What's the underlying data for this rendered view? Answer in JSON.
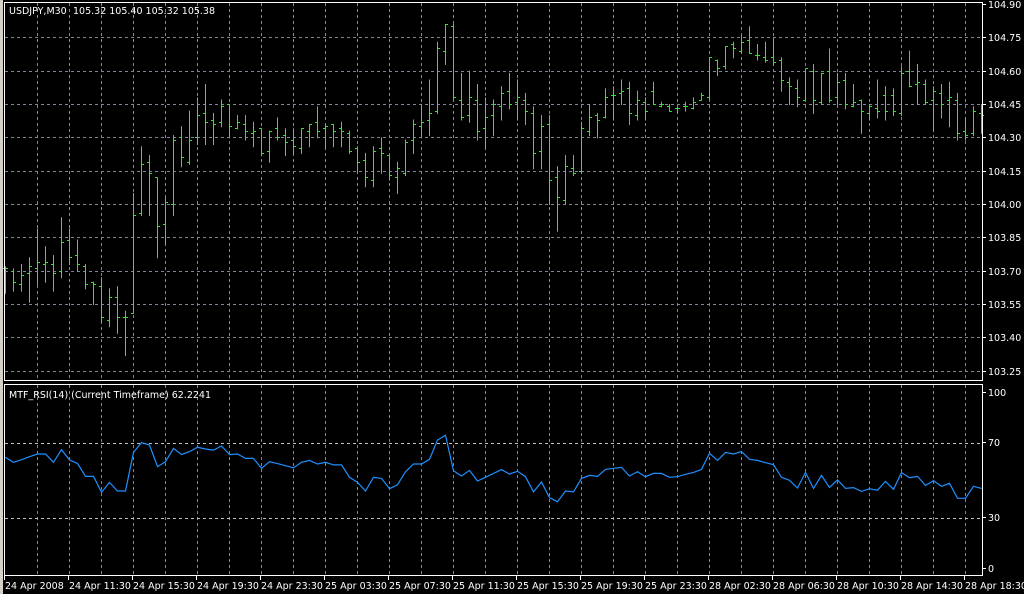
{
  "header": {
    "symbol": "USDJPY,M30",
    "ohlc_text": "105.32 105.40 105.32 105.38"
  },
  "indicator": {
    "label": "MTF_RSI(14) (Current Timeframe) 62.2241"
  },
  "price_axis": [
    "104.90",
    "104.75",
    "104.60",
    "104.45",
    "104.30",
    "104.15",
    "104.00",
    "103.85",
    "103.70",
    "103.55",
    "103.40",
    "103.25"
  ],
  "rsi_axis": [
    "100",
    "70",
    "30",
    "0"
  ],
  "time_axis": [
    "24 Apr 2008",
    "24 Apr 11:30",
    "24 Apr 15:30",
    "24 Apr 19:30",
    "24 Apr 23:30",
    "25 Apr 03:30",
    "25 Apr 07:30",
    "25 Apr 11:30",
    "25 Apr 15:30",
    "25 Apr 19:30",
    "25 Apr 23:30",
    "28 Apr 02:30",
    "28 Apr 06:30",
    "28 Apr 10:30",
    "28 Apr 14:30",
    "28 Apr 18:30"
  ],
  "colors": {
    "bars": "#2ee82e",
    "grid": "#778899",
    "rsi": "#1e90ff",
    "axis": "#ffffff",
    "background": "#000000"
  },
  "chart_data": [
    {
      "type": "ohlc",
      "title": "USDJPY,M30",
      "timeframe": "M30",
      "ylim": [
        103.25,
        104.9
      ],
      "grid": true,
      "bar_format": [
        "open",
        "high",
        "low",
        "close"
      ],
      "bars": [
        [
          103.71,
          103.72,
          103.6,
          103.71
        ],
        [
          103.7,
          103.71,
          103.61,
          103.65
        ],
        [
          103.64,
          103.73,
          103.61,
          103.68
        ],
        [
          103.69,
          103.76,
          103.56,
          103.72
        ],
        [
          103.71,
          103.89,
          103.64,
          103.74
        ],
        [
          103.73,
          103.81,
          103.65,
          103.74
        ],
        [
          103.73,
          103.77,
          103.61,
          103.69
        ],
        [
          103.7,
          103.94,
          103.67,
          103.83
        ],
        [
          103.84,
          103.89,
          103.73,
          103.76
        ],
        [
          103.77,
          103.84,
          103.7,
          103.73
        ],
        [
          103.72,
          103.73,
          103.62,
          103.64
        ],
        [
          103.65,
          103.65,
          103.55,
          103.64
        ],
        [
          103.63,
          103.67,
          103.47,
          103.49
        ],
        [
          103.48,
          103.62,
          103.45,
          103.58
        ],
        [
          103.58,
          103.63,
          103.42,
          103.49
        ],
        [
          103.49,
          103.52,
          103.32,
          103.49
        ],
        [
          103.51,
          104.05,
          103.51,
          103.95
        ],
        [
          103.96,
          104.26,
          103.95,
          104.18
        ],
        [
          104.19,
          104.22,
          103.95,
          104.14
        ],
        [
          104.12,
          104.12,
          103.76,
          103.9
        ],
        [
          103.91,
          104.03,
          103.82,
          104.01
        ],
        [
          104.0,
          104.31,
          103.95,
          104.29
        ],
        [
          104.3,
          104.35,
          104.17,
          104.21
        ],
        [
          104.19,
          104.42,
          104.18,
          104.29
        ],
        [
          104.3,
          104.48,
          104.27,
          104.4
        ],
        [
          104.41,
          104.54,
          104.27,
          104.37
        ],
        [
          104.38,
          104.41,
          104.27,
          104.36
        ],
        [
          104.37,
          104.47,
          104.35,
          104.44
        ],
        [
          104.45,
          104.45,
          104.3,
          104.35
        ],
        [
          104.34,
          104.4,
          104.34,
          104.37
        ],
        [
          104.36,
          104.4,
          104.29,
          104.33
        ],
        [
          104.32,
          104.37,
          104.26,
          104.33
        ],
        [
          104.34,
          104.34,
          104.22,
          104.23
        ],
        [
          104.24,
          104.33,
          104.19,
          104.33
        ],
        [
          104.34,
          104.39,
          104.29,
          104.3
        ],
        [
          104.31,
          104.34,
          104.22,
          104.28
        ],
        [
          104.29,
          104.34,
          104.23,
          104.26
        ],
        [
          104.25,
          104.34,
          104.23,
          104.34
        ],
        [
          104.33,
          104.36,
          104.26,
          104.36
        ],
        [
          104.37,
          104.44,
          104.3,
          104.33
        ],
        [
          104.34,
          104.36,
          104.25,
          104.35
        ],
        [
          104.36,
          104.36,
          104.26,
          104.33
        ],
        [
          104.34,
          104.37,
          104.26,
          104.33
        ],
        [
          104.32,
          104.33,
          104.23,
          104.24
        ],
        [
          104.25,
          104.26,
          104.14,
          104.19
        ],
        [
          104.2,
          104.23,
          104.08,
          104.12
        ],
        [
          104.11,
          104.26,
          104.08,
          104.24
        ],
        [
          104.25,
          104.3,
          104.14,
          104.23
        ],
        [
          104.22,
          104.22,
          104.11,
          104.13
        ],
        [
          104.12,
          104.19,
          104.05,
          104.16
        ],
        [
          104.14,
          104.29,
          104.13,
          104.28
        ],
        [
          104.29,
          104.38,
          104.23,
          104.36
        ],
        [
          104.35,
          104.45,
          104.3,
          104.37
        ],
        [
          104.38,
          104.56,
          104.31,
          104.41
        ],
        [
          104.42,
          104.73,
          104.41,
          104.7
        ],
        [
          104.69,
          104.81,
          104.63,
          104.81
        ],
        [
          104.8,
          104.81,
          104.47,
          104.48
        ],
        [
          104.47,
          104.59,
          104.38,
          104.39
        ],
        [
          104.4,
          104.6,
          104.37,
          104.48
        ],
        [
          104.47,
          104.54,
          104.29,
          104.33
        ],
        [
          104.34,
          104.48,
          104.25,
          104.39
        ],
        [
          104.4,
          104.47,
          104.31,
          104.45
        ],
        [
          104.44,
          104.53,
          104.38,
          104.5
        ],
        [
          104.51,
          104.59,
          104.43,
          104.45
        ],
        [
          104.46,
          104.56,
          104.38,
          104.48
        ],
        [
          104.47,
          104.5,
          104.36,
          104.42
        ],
        [
          104.41,
          104.44,
          104.16,
          104.23
        ],
        [
          104.24,
          104.4,
          104.16,
          104.35
        ],
        [
          104.36,
          104.4,
          104.0,
          104.11
        ],
        [
          104.12,
          104.17,
          103.88,
          104.03
        ],
        [
          104.02,
          104.22,
          104.0,
          104.17
        ],
        [
          104.16,
          104.22,
          104.13,
          104.14
        ],
        [
          104.15,
          104.37,
          104.14,
          104.34
        ],
        [
          104.33,
          104.45,
          104.31,
          104.39
        ],
        [
          104.4,
          104.41,
          104.3,
          104.38
        ],
        [
          104.39,
          104.52,
          104.39,
          104.48
        ],
        [
          104.49,
          104.53,
          104.38,
          104.49
        ],
        [
          104.5,
          104.56,
          104.45,
          104.51
        ],
        [
          104.52,
          104.55,
          104.36,
          104.41
        ],
        [
          104.4,
          104.51,
          104.38,
          104.47
        ],
        [
          104.46,
          104.48,
          104.38,
          104.42
        ],
        [
          104.51,
          104.55,
          104.45,
          104.45
        ],
        [
          104.44,
          104.46,
          104.44,
          104.45
        ],
        [
          104.44,
          104.45,
          104.42,
          104.42
        ],
        [
          104.43,
          104.44,
          104.41,
          104.43
        ],
        [
          104.44,
          104.46,
          104.42,
          104.44
        ],
        [
          104.43,
          104.48,
          104.43,
          104.46
        ],
        [
          104.47,
          104.5,
          104.47,
          104.49
        ],
        [
          104.48,
          104.66,
          104.47,
          104.66
        ],
        [
          104.65,
          104.65,
          104.58,
          104.61
        ],
        [
          104.62,
          104.71,
          104.61,
          104.71
        ],
        [
          104.72,
          104.73,
          104.66,
          104.7
        ],
        [
          104.69,
          104.76,
          104.68,
          104.73
        ],
        [
          104.74,
          104.8,
          104.68,
          104.68
        ],
        [
          104.67,
          104.72,
          104.65,
          104.67
        ],
        [
          104.66,
          104.73,
          104.64,
          104.65
        ],
        [
          104.66,
          104.75,
          104.63,
          104.64
        ],
        [
          104.65,
          104.66,
          104.51,
          104.56
        ],
        [
          104.55,
          104.57,
          104.45,
          104.53
        ],
        [
          104.52,
          104.56,
          104.44,
          104.48
        ],
        [
          104.47,
          104.61,
          104.47,
          104.61
        ],
        [
          104.6,
          104.63,
          104.41,
          104.47
        ],
        [
          104.46,
          104.59,
          104.45,
          104.59
        ],
        [
          104.6,
          104.7,
          104.46,
          104.47
        ],
        [
          104.48,
          104.59,
          104.45,
          104.55
        ],
        [
          104.56,
          104.59,
          104.43,
          104.45
        ],
        [
          104.44,
          104.54,
          104.44,
          104.46
        ],
        [
          104.47,
          104.47,
          104.32,
          104.42
        ],
        [
          104.41,
          104.45,
          104.38,
          104.44
        ],
        [
          104.43,
          104.56,
          104.39,
          104.42
        ],
        [
          104.49,
          104.53,
          104.38,
          104.42
        ],
        [
          104.49,
          104.52,
          104.4,
          104.42
        ],
        [
          104.41,
          104.62,
          104.4,
          104.59
        ],
        [
          104.6,
          104.69,
          104.53,
          104.53
        ],
        [
          104.54,
          104.63,
          104.45,
          104.55
        ],
        [
          104.54,
          104.56,
          104.45,
          104.46
        ],
        [
          104.47,
          104.53,
          104.33,
          104.51
        ],
        [
          104.5,
          104.54,
          104.39,
          104.45
        ],
        [
          104.47,
          104.55,
          104.35,
          104.48
        ],
        [
          104.47,
          104.5,
          104.29,
          104.32
        ],
        [
          104.33,
          104.39,
          104.29,
          104.31
        ],
        [
          104.32,
          104.44,
          104.31,
          104.42
        ],
        [
          104.41,
          104.45,
          104.32,
          104.4
        ]
      ]
    },
    {
      "type": "line",
      "title": "MTF_RSI(14) (Current Timeframe)",
      "ylim": [
        0,
        100
      ],
      "levels": [
        70,
        30
      ],
      "values": [
        62.5,
        59.9,
        61.3,
        62.9,
        64.3,
        64.3,
        59.9,
        66.6,
        61.1,
        59.3,
        52.4,
        52.4,
        43.9,
        49.2,
        44.6,
        44.6,
        65.2,
        70.4,
        69.1,
        57.6,
        60.2,
        67.3,
        64.0,
        65.6,
        67.9,
        67.0,
        66.4,
        68.6,
        64.0,
        64.3,
        62.0,
        62.0,
        56.7,
        60.2,
        59.2,
        58.1,
        56.9,
        59.9,
        60.9,
        59.0,
        59.9,
        58.5,
        58.5,
        51.9,
        49.2,
        44.6,
        51.9,
        51.3,
        45.8,
        47.9,
        54.9,
        59.0,
        59.0,
        61.5,
        71.8,
        74.3,
        55.4,
        52.6,
        55.6,
        49.9,
        51.9,
        54.0,
        56.0,
        53.6,
        55.1,
        52.2,
        44.1,
        49.4,
        41.0,
        38.9,
        44.6,
        44.1,
        51.3,
        52.9,
        52.4,
        56.1,
        56.7,
        57.2,
        52.6,
        54.9,
        52.2,
        54.0,
        54.0,
        51.9,
        52.2,
        53.5,
        54.5,
        56.1,
        64.7,
        60.9,
        65.2,
        64.3,
        65.6,
        61.5,
        60.9,
        59.7,
        58.6,
        51.9,
        50.3,
        46.2,
        54.5,
        46.0,
        52.9,
        46.5,
        50.5,
        46.0,
        46.4,
        44.4,
        45.8,
        45.0,
        49.7,
        45.5,
        54.4,
        51.7,
        52.4,
        47.6,
        50.1,
        47.1,
        48.7,
        40.7,
        40.7,
        47.1,
        46.0
      ]
    }
  ]
}
